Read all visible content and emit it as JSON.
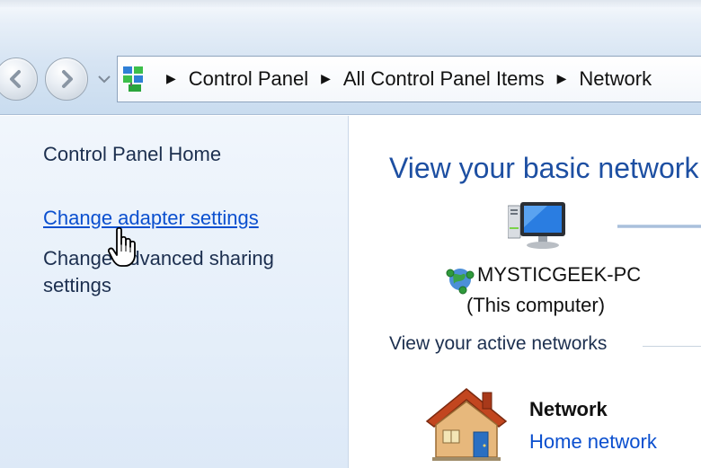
{
  "address_bar": {
    "breadcrumbs": [
      "Control Panel",
      "All Control Panel Items",
      "Network"
    ],
    "icon": "control-panel-icon"
  },
  "navigation": {
    "back_icon": "back-arrow-icon",
    "forward_icon": "forward-arrow-icon",
    "history_icon": "chevron-down-icon"
  },
  "sidebar": {
    "items": [
      {
        "label": "Control Panel Home",
        "link": false
      },
      {
        "label": "Change adapter settings",
        "link": true
      },
      {
        "label": "Change advanced sharing settings",
        "link": false
      }
    ]
  },
  "main": {
    "title": "View your basic network",
    "computer": {
      "icon": "computer-monitor-icon",
      "name": "MYSTICGEEK-PC",
      "subtitle": "(This computer)"
    },
    "active_networks_label": "View your active networks",
    "network": {
      "icon": "home-network-icon",
      "name": "Network",
      "type": "Home network"
    }
  },
  "colors": {
    "link": "#0a4fcf",
    "title": "#1d4fa2",
    "pane_bg": "#e7f0fa"
  }
}
